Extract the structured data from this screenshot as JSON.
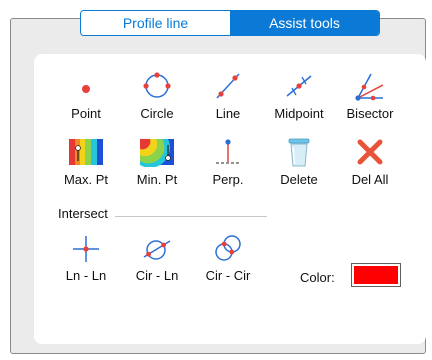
{
  "tabs": [
    {
      "label": "Profile line",
      "active": false
    },
    {
      "label": "Assist tools",
      "active": true
    }
  ],
  "tools": {
    "point": "Point",
    "circle": "Circle",
    "line": "Line",
    "midpoint": "Midpoint",
    "bisector": "Bisector",
    "max_pt": "Max. Pt",
    "min_pt": "Min. Pt",
    "perp": "Perp.",
    "delete": "Delete",
    "del_all": "Del All"
  },
  "intersect": {
    "label": "Intersect",
    "ln_ln": "Ln - Ln",
    "cir_ln": "Cir - Ln",
    "cir_cir": "Cir - Cir"
  },
  "color": {
    "label": "Color:",
    "value": "#ff0000"
  },
  "colors": {
    "accent": "#0a7ad6",
    "tool_red": "#e8403a",
    "tool_blue": "#2b6fd6"
  },
  "icons": [
    "point-icon",
    "circle-icon",
    "line-icon",
    "midpoint-icon",
    "bisector-icon",
    "max-point-icon",
    "min-point-icon",
    "perpendicular-icon",
    "trash-icon",
    "close-icon",
    "line-line-intersect-icon",
    "circle-line-intersect-icon",
    "circle-circle-intersect-icon"
  ]
}
